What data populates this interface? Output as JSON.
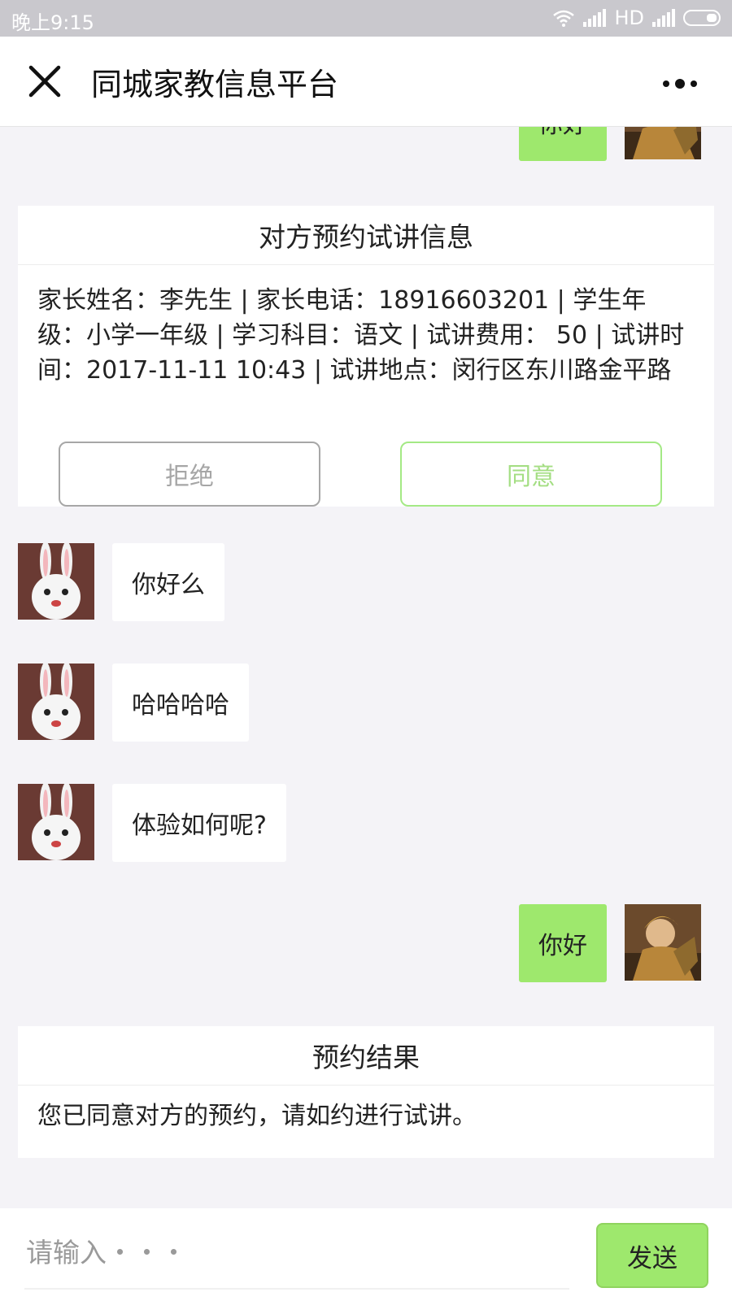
{
  "status_bar": {
    "time": "晚上9:15",
    "network": "HD"
  },
  "header": {
    "title": "同城家教信息平台",
    "close_icon": "close-icon",
    "more_icon": "more-icon"
  },
  "messages": [
    {
      "side": "right",
      "text": "你好",
      "avatar": "armored-hero-avatar"
    },
    {
      "side": "left",
      "text": "你好么",
      "avatar": "white-rabbit-avatar"
    },
    {
      "side": "left",
      "text": "哈哈哈哈",
      "avatar": "white-rabbit-avatar"
    },
    {
      "side": "left",
      "text": "体验如何呢?",
      "avatar": "white-rabbit-avatar"
    },
    {
      "side": "right",
      "text": "你好",
      "avatar": "armored-hero-avatar"
    }
  ],
  "appointment_card": {
    "title": "对方预约试讲信息",
    "details": "家长姓名：李先生 | 家长电话：18916603201 | 学生年级：小学一年级 | 学习科目：语文 | 试讲费用： 50 | 试讲时间：2017-11-11 10:43 | 试讲地点：闵行区东川路金平路",
    "reject_label": "拒绝",
    "agree_label": "同意"
  },
  "result_card": {
    "title": "预约结果",
    "text": "您已同意对方的预约，请如约进行试讲。"
  },
  "input_bar": {
    "placeholder": "请输入・・・",
    "value": "",
    "send_label": "发送"
  },
  "colors": {
    "accent_green": "#9ee86d",
    "agree_border": "#a4e985",
    "background": "#f4f3f7"
  }
}
